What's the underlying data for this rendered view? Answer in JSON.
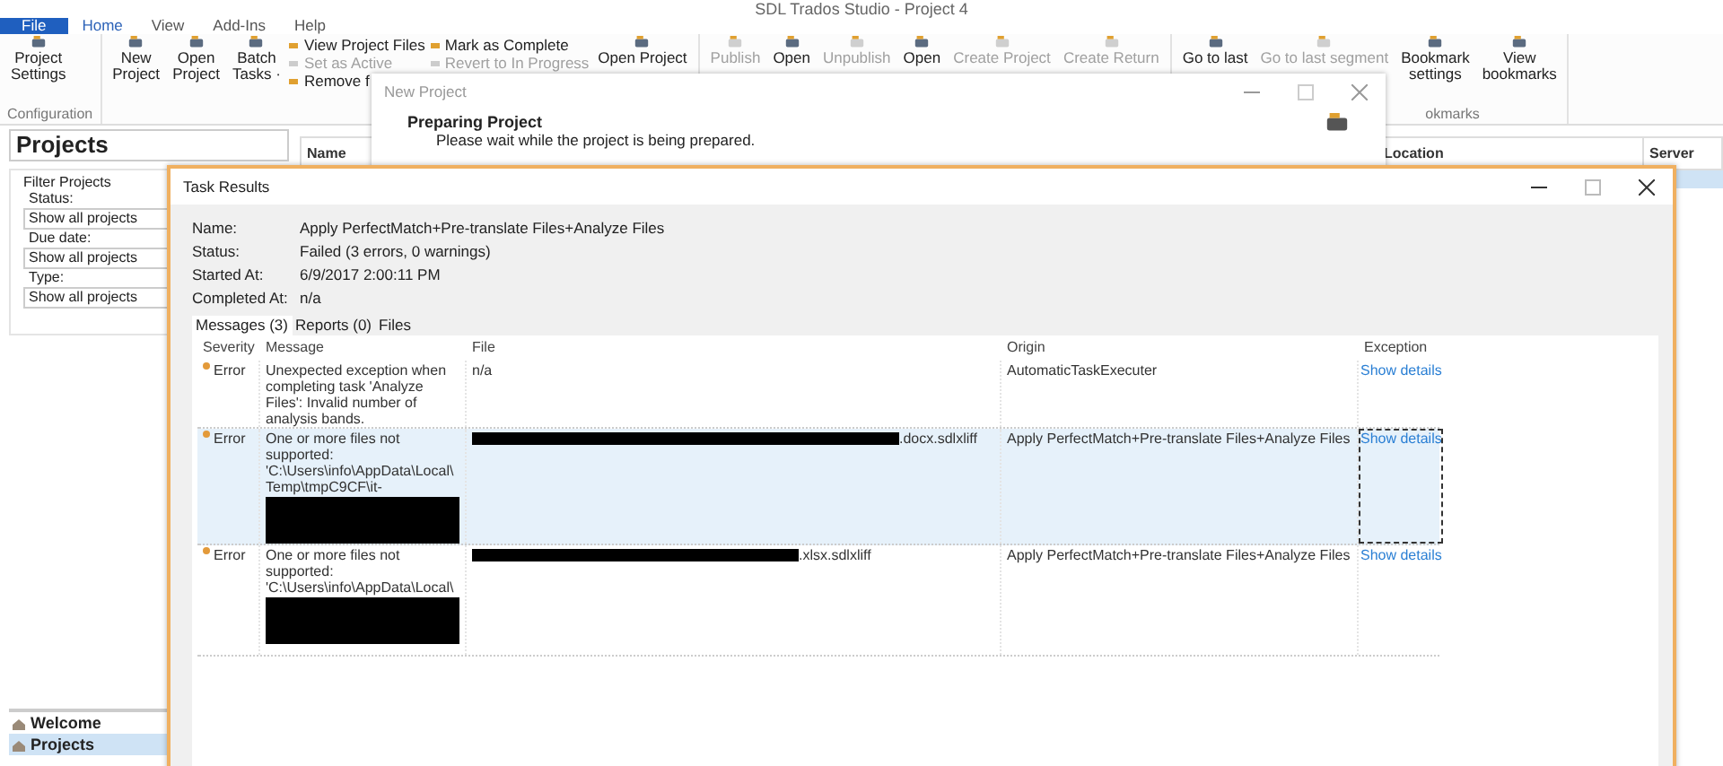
{
  "app": {
    "title": "SDL Trados Studio - Project 4"
  },
  "menu": [
    {
      "label": "File",
      "kind": "file",
      "selected": false
    },
    {
      "label": "Home",
      "kind": "tab",
      "selected": true
    },
    {
      "label": "View",
      "kind": "tab",
      "selected": false
    },
    {
      "label": "Add-Ins",
      "kind": "tab",
      "selected": false
    },
    {
      "label": "Help",
      "kind": "tab",
      "selected": false
    }
  ],
  "ribbon": {
    "groups": [
      {
        "label": "Configuration",
        "items": [
          {
            "kind": "large",
            "lines": [
              "Project",
              "Settings"
            ],
            "disabled": false
          }
        ]
      },
      {
        "items": [
          {
            "kind": "large",
            "lines": [
              "New",
              "Project"
            ],
            "disabled": false
          },
          {
            "kind": "large",
            "lines": [
              "Open",
              "Project"
            ],
            "disabled": false
          },
          {
            "kind": "large",
            "lines": [
              "Batch",
              "Tasks ·"
            ],
            "disabled": false
          },
          {
            "kind": "stack",
            "buttons": [
              {
                "label": "View Project Files",
                "disabled": false
              },
              {
                "label": "Set as Active",
                "disabled": true
              },
              {
                "label": "Remove f",
                "disabled": false
              }
            ]
          },
          {
            "kind": "stack",
            "buttons": [
              {
                "label": "Mark as Complete",
                "disabled": false
              },
              {
                "label": "Revert to In Progress",
                "disabled": true
              }
            ]
          },
          {
            "kind": "large",
            "lines": [
              "Open Project"
            ],
            "disabled": false
          }
        ]
      },
      {
        "items": [
          {
            "kind": "large",
            "lines": [
              "Publish"
            ],
            "disabled": true
          },
          {
            "kind": "large",
            "lines": [
              "Open"
            ],
            "disabled": false
          },
          {
            "kind": "large",
            "lines": [
              "Unpublish"
            ],
            "disabled": true
          },
          {
            "kind": "large",
            "lines": [
              "Open"
            ],
            "disabled": false
          },
          {
            "kind": "large",
            "lines": [
              "Create Project"
            ],
            "disabled": true
          },
          {
            "kind": "large",
            "lines": [
              "Create Return"
            ],
            "disabled": true
          }
        ]
      },
      {
        "label": "okmarks",
        "items": [
          {
            "kind": "large",
            "lines": [
              "Go to last"
            ],
            "disabled": false
          },
          {
            "kind": "large",
            "lines": [
              "Go to last segment"
            ],
            "disabled": true
          },
          {
            "kind": "large",
            "lines": [
              "Bookmark",
              "settings"
            ],
            "disabled": false
          },
          {
            "kind": "large",
            "lines": [
              "View",
              "bookmarks"
            ],
            "disabled": false
          }
        ]
      }
    ]
  },
  "projects_panel": {
    "title": "Projects",
    "filter_title": "Filter Projects",
    "filters": [
      {
        "label": "Status:",
        "value": "Show all projects"
      },
      {
        "label": "Due date:",
        "value": "Show all projects"
      },
      {
        "label": "Type:",
        "value": "Show all projects"
      }
    ]
  },
  "navigation": [
    {
      "label": "Welcome",
      "selected": false
    },
    {
      "label": "Projects",
      "selected": true
    }
  ],
  "project_list": {
    "columns": [
      "Name",
      "Location",
      "Server"
    ],
    "rows": [
      {
        "selected": true
      }
    ]
  },
  "new_project_dialog": {
    "title": "New Project",
    "heading": "Preparing Project",
    "message": "Please wait while the project is being prepared."
  },
  "task_results": {
    "title": "Task Results",
    "details": [
      {
        "label": "Name:",
        "value": "Apply PerfectMatch+Pre-translate Files+Analyze Files"
      },
      {
        "label": "Status:",
        "value": "Failed (3 errors, 0 warnings)"
      },
      {
        "label": "Started At:",
        "value": "6/9/2017 2:00:11 PM"
      },
      {
        "label": "Completed At:",
        "value": "n/a"
      }
    ],
    "tabs": [
      {
        "label": "Messages (3)",
        "selected": true
      },
      {
        "label": "Reports (0)",
        "selected": false
      },
      {
        "label": "Files",
        "selected": false
      }
    ],
    "columns": [
      "Severity",
      "Message",
      "File",
      "Origin",
      "Exception"
    ],
    "rows": [
      {
        "severity": "Error",
        "message": "Unexpected exception when completing task 'Analyze Files': Invalid number of analysis bands.",
        "message_redacted": false,
        "file": "n/a",
        "file_redacted": false,
        "origin": "AutomaticTaskExecuter",
        "exception": "Show details",
        "selected": false
      },
      {
        "severity": "Error",
        "message": "One or more files not supported: 'C:\\Users\\info\\AppData\\Local\\ Temp\\tmpC9CF\\it-",
        "message_redacted": true,
        "file": ".docx.sdlxliff",
        "file_redacted": true,
        "origin": "Apply PerfectMatch+Pre-translate Files+Analyze Files",
        "exception": "Show details",
        "selected": true
      },
      {
        "severity": "Error",
        "message": "One or more files not supported: 'C:\\Users\\info\\AppData\\Local\\",
        "message_redacted": true,
        "file": ".xlsx.sdlxliff",
        "file_redacted": true,
        "origin": "Apply PerfectMatch+Pre-translate Files+Analyze Files",
        "exception": "Show details",
        "selected": false
      }
    ]
  }
}
